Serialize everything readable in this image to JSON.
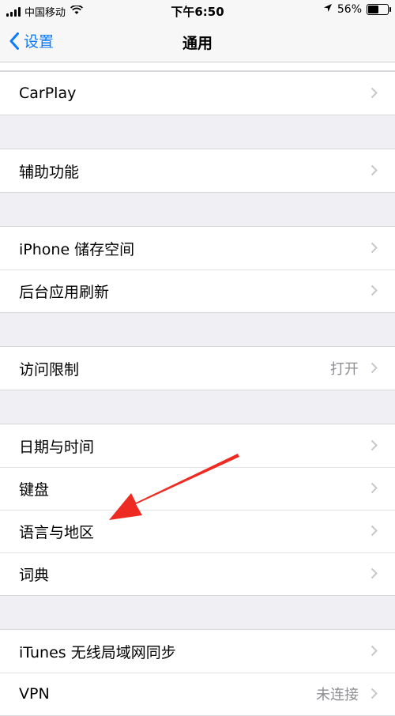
{
  "status_bar": {
    "carrier": "中国移动",
    "time": "下午6:50",
    "battery": "56%",
    "battery_level": 0.56
  },
  "nav": {
    "back_label": "设置",
    "title": "通用"
  },
  "groups": [
    {
      "rows": [
        {
          "label": "CarPlay"
        }
      ]
    },
    {
      "rows": [
        {
          "label": "辅助功能"
        }
      ]
    },
    {
      "rows": [
        {
          "label": "iPhone 储存空间"
        },
        {
          "label": "后台应用刷新"
        }
      ]
    },
    {
      "rows": [
        {
          "label": "访问限制",
          "value": "打开"
        }
      ]
    },
    {
      "rows": [
        {
          "label": "日期与时间"
        },
        {
          "label": "键盘"
        },
        {
          "label": "语言与地区"
        },
        {
          "label": "词典"
        }
      ]
    },
    {
      "rows": [
        {
          "label": "iTunes 无线局域网同步"
        },
        {
          "label": "VPN",
          "value": "未连接"
        }
      ]
    }
  ],
  "annotation": {
    "arrow_color": "#ee2b23"
  },
  "colors": {
    "accent": "#0a7aff",
    "background": "#efeff4"
  }
}
